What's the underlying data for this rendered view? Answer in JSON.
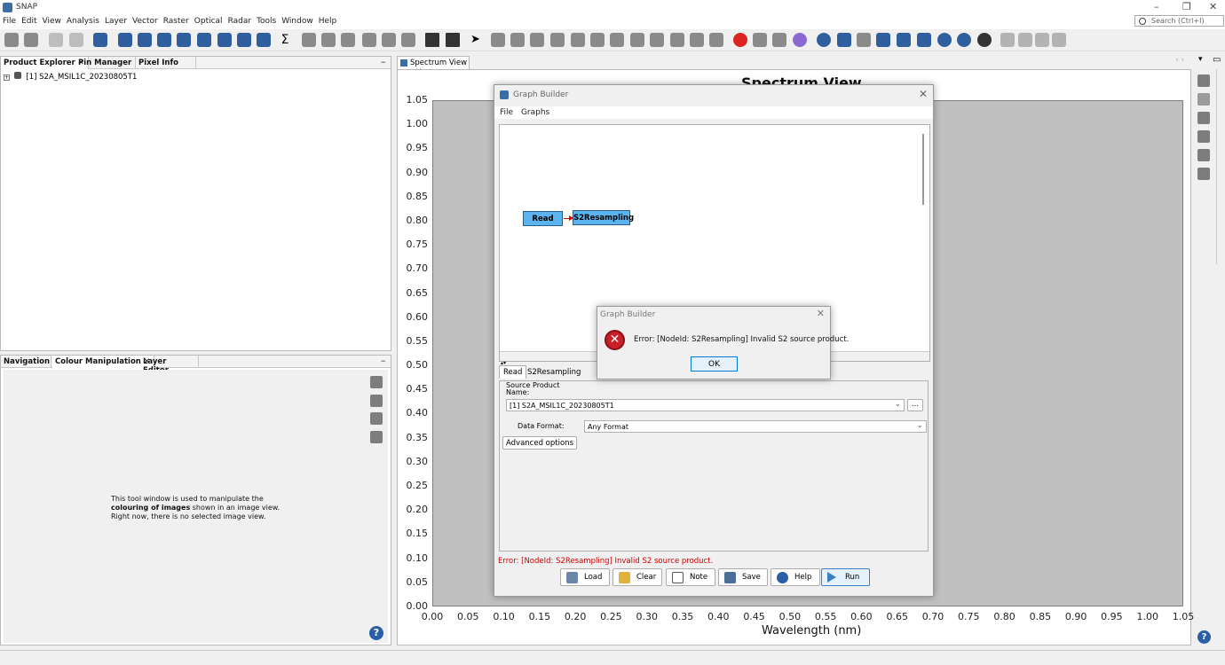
{
  "app": {
    "title": "SNAP"
  },
  "menu": [
    "File",
    "Edit",
    "View",
    "Analysis",
    "Layer",
    "Vector",
    "Raster",
    "Optical",
    "Radar",
    "Tools",
    "Window",
    "Help"
  ],
  "search": {
    "placeholder": "Search (Ctrl+I)"
  },
  "product_explorer": {
    "tabs": [
      {
        "label": "Product Explorer",
        "closable": true
      },
      {
        "label": "Pin Manager"
      },
      {
        "label": "Pixel Info"
      }
    ],
    "product": "[1] S2A_MSIL1C_20230805T1"
  },
  "colour_panel": {
    "tabs": [
      {
        "label": "Navigation"
      },
      {
        "label": "Colour Manipulation",
        "closable": true
      },
      {
        "label": "Layer Editor"
      }
    ],
    "message_line1": "This tool window is used to manipulate the",
    "message_bold": "colouring of images",
    "message_line2_rest": " shown in an image view.",
    "message_line3": "Right now, there is no selected image view."
  },
  "spectrum": {
    "tab_label": "Spectrum View",
    "title": "Spectrum View",
    "xlabel": "Wavelength (nm)",
    "yticks": [
      "1.05",
      "1.00",
      "0.95",
      "0.90",
      "0.85",
      "0.80",
      "0.75",
      "0.70",
      "0.65",
      "0.60",
      "0.55",
      "0.50",
      "0.45",
      "0.40",
      "0.35",
      "0.30",
      "0.25",
      "0.20",
      "0.15",
      "0.10",
      "0.05",
      "0.00"
    ],
    "xticks": [
      "0.00",
      "0.05",
      "0.10",
      "0.15",
      "0.20",
      "0.25",
      "0.30",
      "0.35",
      "0.40",
      "0.45",
      "0.50",
      "0.55",
      "0.60",
      "0.65",
      "0.70",
      "0.75",
      "0.80",
      "0.85",
      "0.90",
      "0.95",
      "1.00",
      "1.05"
    ]
  },
  "graph_builder": {
    "title": "Graph Builder",
    "menu": [
      "File",
      "Graphs"
    ],
    "nodes": {
      "read": "Read",
      "resample": "S2Resampling"
    },
    "tabs": [
      "Read",
      "S2Resampling"
    ],
    "source_product_label": "Source Product",
    "name_label": "Name:",
    "source_product_value": "[1] S2A_MSIL1C_20230805T1",
    "browse_label": "...",
    "data_format_label": "Data Format:",
    "data_format_value": "Any Format",
    "advanced_label": "Advanced options",
    "error_text": "Error: [NodeId: S2Resampling] Invalid S2 source product.",
    "buttons": {
      "load": "Load",
      "clear": "Clear",
      "note": "Note",
      "save": "Save",
      "help": "Help",
      "run": "Run"
    }
  },
  "error_dialog": {
    "title": "Graph Builder",
    "message": "Error: [NodeId: S2Resampling] Invalid S2 source product.",
    "ok": "OK"
  }
}
